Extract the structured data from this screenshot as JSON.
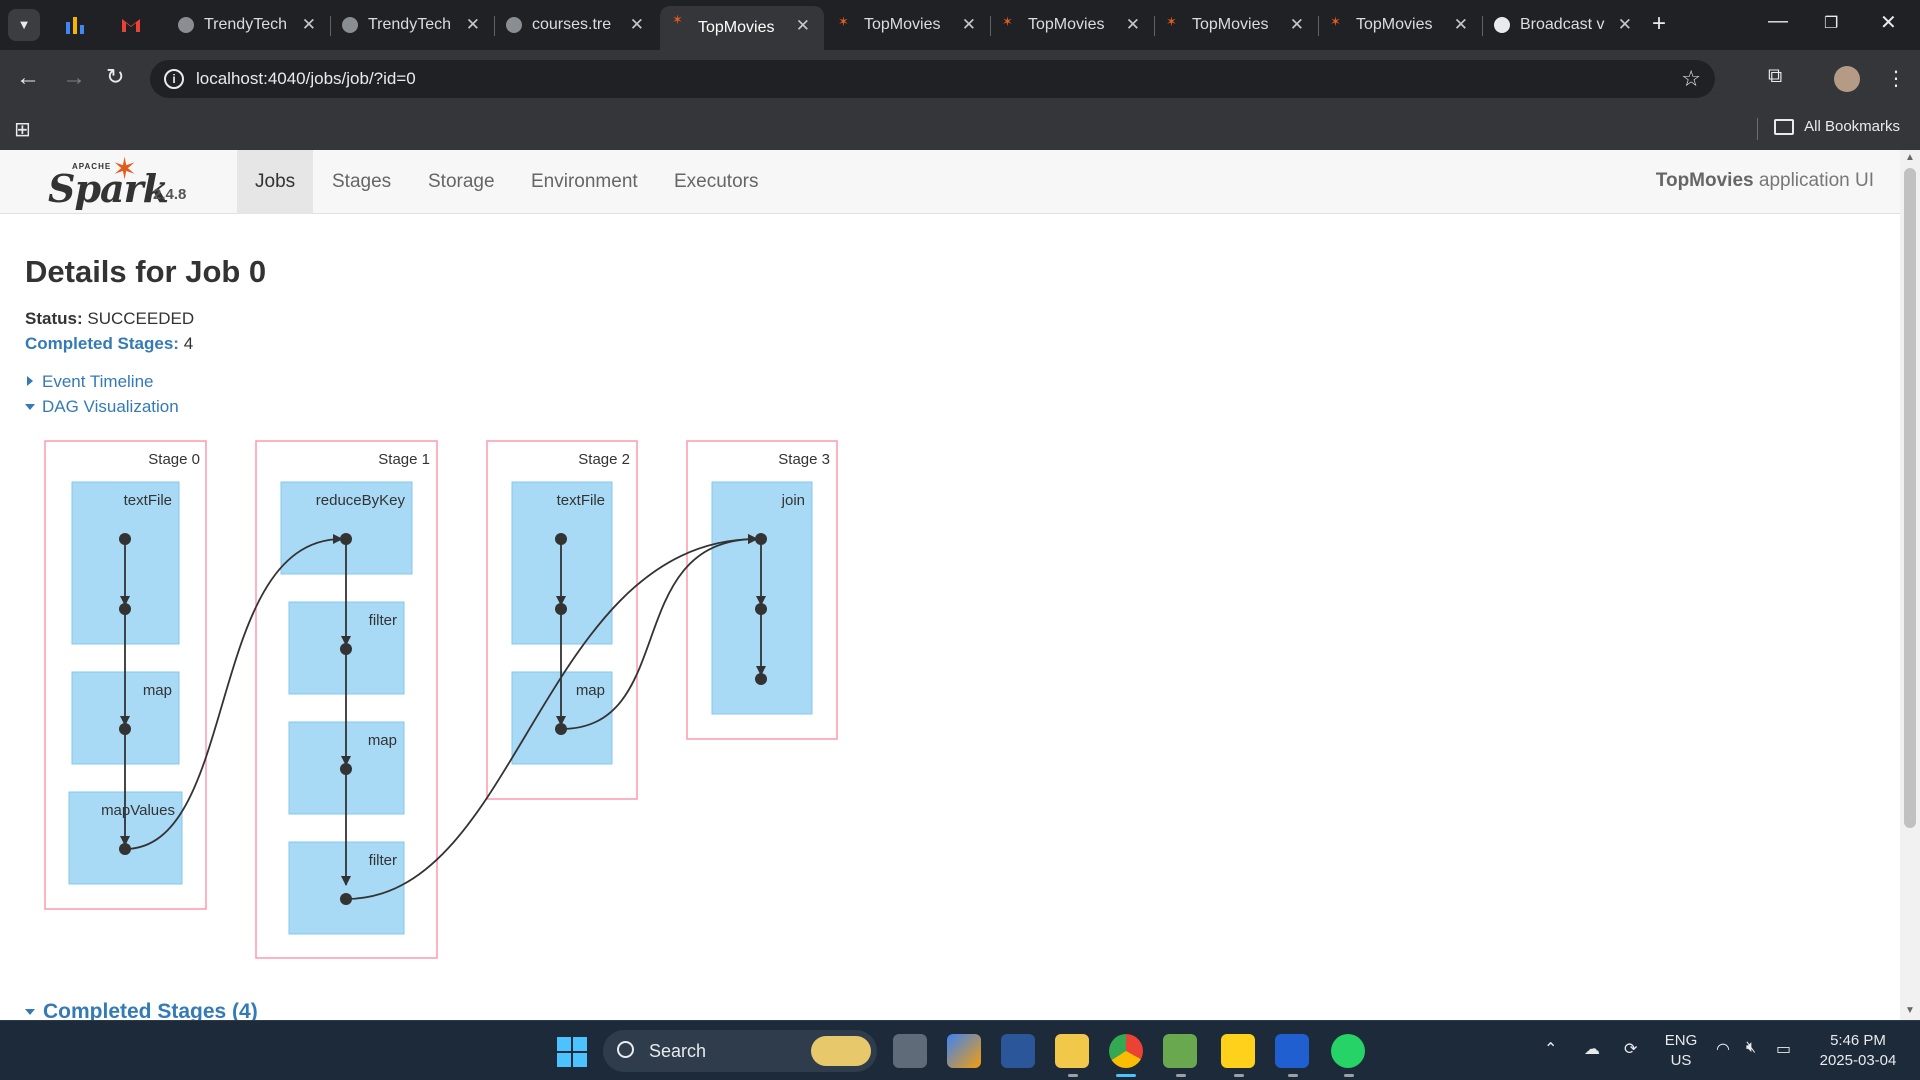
{
  "browser": {
    "tabs": [
      {
        "title": "TrendyTech",
        "kind": "globe"
      },
      {
        "title": "TrendyTech",
        "kind": "globe"
      },
      {
        "title": "courses.tre",
        "kind": "globe"
      },
      {
        "title": "TopMovies",
        "kind": "spark",
        "active": true
      },
      {
        "title": "TopMovies",
        "kind": "spark"
      },
      {
        "title": "TopMovies",
        "kind": "spark"
      },
      {
        "title": "TopMovies",
        "kind": "spark"
      },
      {
        "title": "TopMovies",
        "kind": "spark"
      },
      {
        "title": "Broadcast v",
        "kind": "openai"
      }
    ],
    "address": "localhost:4040/jobs/job/?id=0",
    "all_bookmarks": "All Bookmarks"
  },
  "spark": {
    "logo_apache": "APACHE",
    "logo_spark": "Spark",
    "version": "2.4.8",
    "nav": [
      "Jobs",
      "Stages",
      "Storage",
      "Environment",
      "Executors"
    ],
    "app_name": "TopMovies",
    "app_suffix": "application UI",
    "title": "Details for Job 0",
    "status_label": "Status:",
    "status_value": "SUCCEEDED",
    "completed_label": "Completed Stages:",
    "completed_value": "4",
    "event_timeline": "Event Timeline",
    "dag_visualization": "DAG Visualization",
    "completed_section": "Completed Stages (4)",
    "dag": {
      "stages": [
        {
          "label": "Stage 0",
          "ops": [
            "textFile",
            "map",
            "mapValues"
          ]
        },
        {
          "label": "Stage 1",
          "ops": [
            "reduceByKey",
            "filter",
            "map",
            "filter"
          ]
        },
        {
          "label": "Stage 2",
          "ops": [
            "textFile",
            "map"
          ]
        },
        {
          "label": "Stage 3",
          "ops": [
            "join"
          ]
        }
      ]
    }
  },
  "taskbar": {
    "search": "Search",
    "lang_top": "ENG",
    "lang_bottom": "US",
    "time": "5:46 PM",
    "date": "2025-03-04"
  }
}
